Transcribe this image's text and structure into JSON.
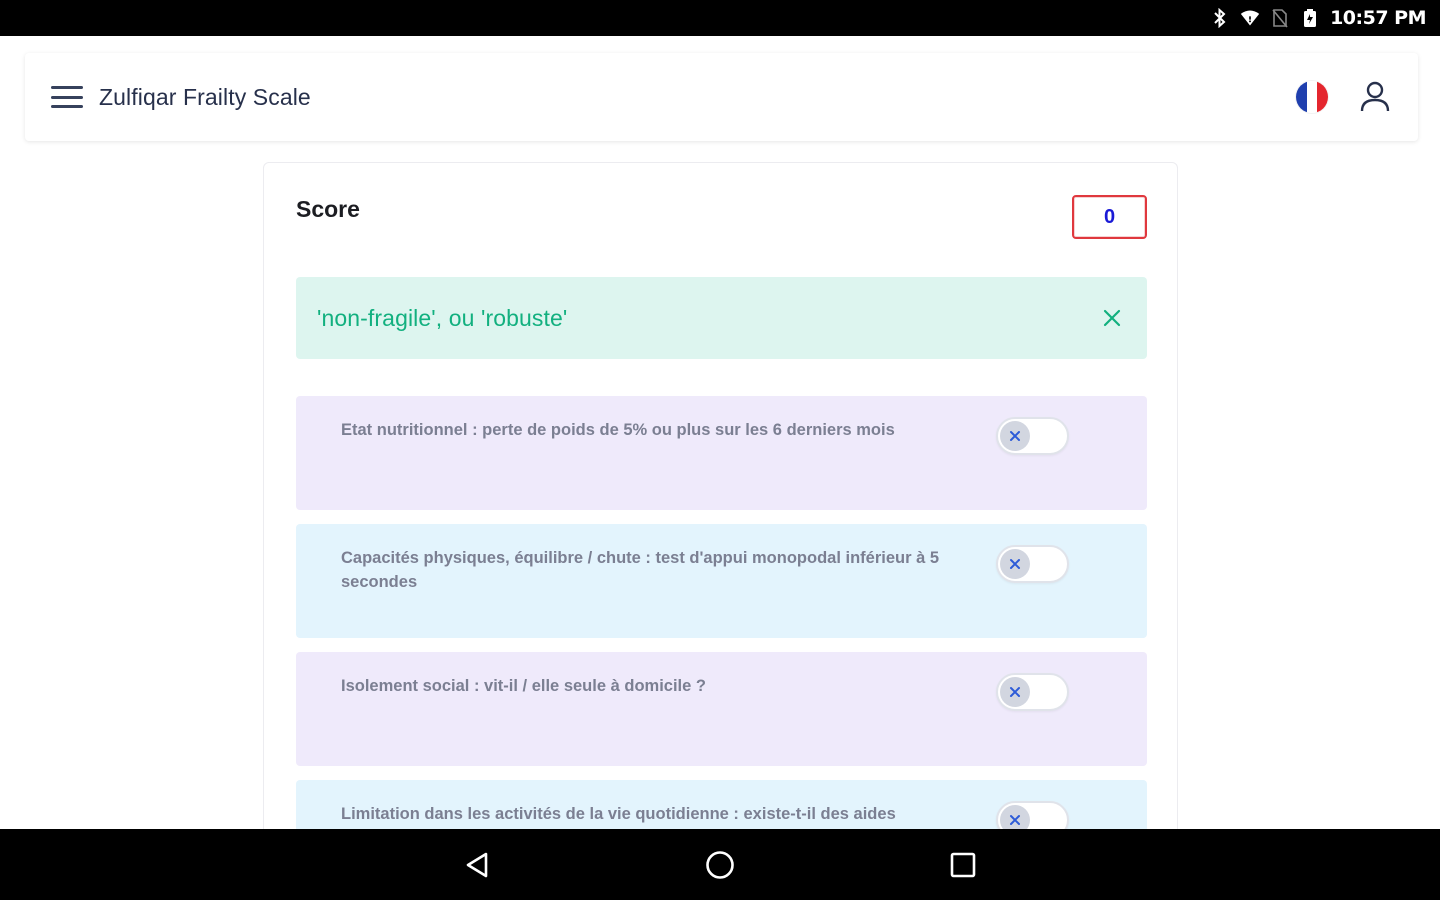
{
  "status_bar": {
    "time": "10:57 PM",
    "icons": [
      "bluetooth-icon",
      "wifi-icon",
      "no-sim-icon",
      "battery-icon"
    ]
  },
  "app_bar": {
    "title": "Zulfiqar Frailty Scale",
    "menu_icon": "hamburger-menu-icon",
    "language_flag": "france-flag-icon",
    "account_icon": "user-account-icon"
  },
  "score": {
    "label": "Score",
    "value": "0"
  },
  "result": {
    "text": "'non-fragile', ou 'robuste'",
    "close_icon": "close-icon",
    "color": "#12b07f"
  },
  "questions": [
    {
      "text": "Etat nutritionnel : perte de poids de 5% ou plus sur les 6 derniers mois",
      "checked": false
    },
    {
      "text": "Capacités physiques, équilibre / chute : test d'appui monopodal inférieur à 5 secondes",
      "checked": false
    },
    {
      "text": "Isolement social : vit-il / elle seule à domicile ?",
      "checked": false
    },
    {
      "text": "Limitation dans les activités de la vie quotidienne : existe-t-il des aides",
      "checked": false
    }
  ],
  "nav_bar": {
    "icons": [
      "back-icon",
      "home-icon",
      "recents-icon"
    ]
  },
  "colors": {
    "accent_red": "#e0383e",
    "score_blue": "#1a1ad6",
    "banner_bg": "#ddf5ef",
    "question_lavender": "#efeafb",
    "question_blue": "#e3f4fd"
  }
}
